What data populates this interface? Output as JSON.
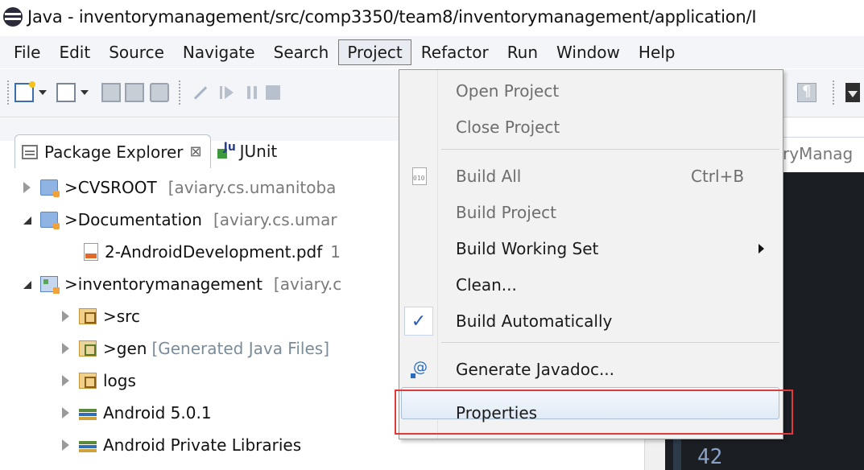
{
  "window": {
    "title": "Java - inventorymanagement/src/comp3350/team8/inventorymanagement/application/I"
  },
  "menubar": {
    "items": [
      "File",
      "Edit",
      "Source",
      "Navigate",
      "Search",
      "Project",
      "Refactor",
      "Run",
      "Window",
      "Help"
    ],
    "open_item": "Project"
  },
  "explorer": {
    "tabs": [
      {
        "label": "Package Explorer",
        "close_glyph": "⊠"
      },
      {
        "label": "JUnit"
      }
    ],
    "tree": [
      {
        "label": ">CVSROOT",
        "suffix": "[aviary.cs.umanitoba"
      },
      {
        "label": ">Documentation",
        "suffix": "[aviary.cs.umar"
      },
      {
        "label": "2-AndroidDevelopment.pdf",
        "suffix": "1"
      },
      {
        "label": ">inventorymanagement",
        "suffix": "[aviary.c"
      },
      {
        "label": ">src"
      },
      {
        "label": ">gen",
        "suffix": "[Generated Java Files]"
      },
      {
        "label": "logs"
      },
      {
        "label": "Android 5.0.1"
      },
      {
        "label": "Android Private Libraries"
      }
    ]
  },
  "editor": {
    "tab_label": "ryManag",
    "line_number": "42"
  },
  "project_menu": {
    "items": [
      {
        "label": "Open Project",
        "enabled": false
      },
      {
        "label": "Close Project",
        "enabled": false
      },
      {
        "label": "Build All",
        "shortcut": "Ctrl+B",
        "enabled": false
      },
      {
        "label": "Build Project",
        "enabled": false
      },
      {
        "label": "Build Working Set",
        "enabled": true,
        "submenu": true
      },
      {
        "label": "Clean...",
        "enabled": true
      },
      {
        "label": "Build Automatically",
        "enabled": true,
        "checked": true
      },
      {
        "label": "Generate Javadoc...",
        "enabled": true
      },
      {
        "label": "Properties",
        "enabled": true,
        "hovered": true
      }
    ],
    "check_glyph": "✓"
  },
  "colors": {
    "highlight_border": "#e03a3a",
    "check_mark": "#2a5bb8",
    "menubar_bg": "#f3f5f8"
  }
}
